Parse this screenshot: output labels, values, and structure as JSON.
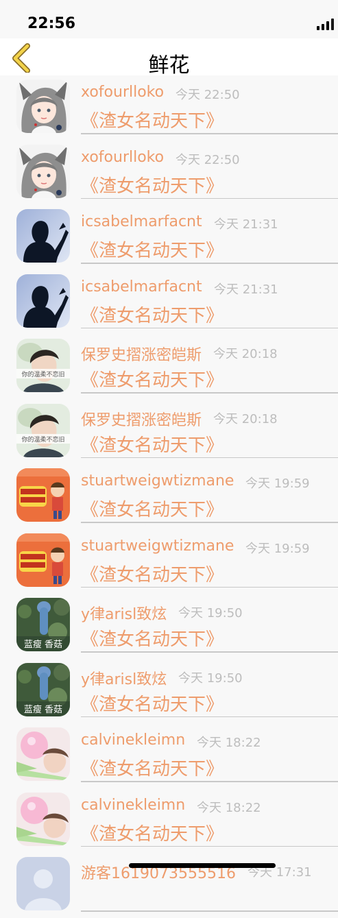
{
  "status_bar": {
    "time": "22:56"
  },
  "nav": {
    "title": "鲜花",
    "back_icon": "chevron-left-icon"
  },
  "accent_color": "#ee9c6c",
  "items": [
    {
      "name": "xofourlloko",
      "time": "今天 22:50",
      "content": "《渣女名动天下》",
      "avatar": "anime-girl"
    },
    {
      "name": "xofourlloko",
      "time": "今天 22:50",
      "content": "《渣女名动天下》",
      "avatar": "anime-girl"
    },
    {
      "name": "icsabelmarfacnt",
      "time": "今天 21:31",
      "content": "《渣女名动天下》",
      "avatar": "silhouette"
    },
    {
      "name": "icsabelmarfacnt",
      "time": "今天 21:31",
      "content": "《渣女名动天下》",
      "avatar": "silhouette"
    },
    {
      "name": "保罗史摺涨密皑斯",
      "time": "今天 20:18",
      "content": "《渣女名动天下》",
      "avatar": "boy",
      "avatar_caption": "你的温柔不恋旧"
    },
    {
      "name": "保罗史摺涨密皑斯",
      "time": "今天 20:18",
      "content": "《渣女名动天下》",
      "avatar": "boy",
      "avatar_caption": "你的温柔不恋旧"
    },
    {
      "name": "stuartweigwtizmane",
      "time": "今天 19:59",
      "content": "《渣女名动天下》",
      "avatar": "cartoon"
    },
    {
      "name": "stuartweigwtizmane",
      "time": "今天 19:59",
      "content": "《渣女名动天下》",
      "avatar": "cartoon"
    },
    {
      "name": "y律arisl致炫",
      "time": "今天 19:50",
      "content": "《渣女名动天下》",
      "avatar": "mushroom",
      "avatar_caption": "蓝瘦 香菇"
    },
    {
      "name": "y律arisl致炫",
      "time": "今天 19:50",
      "content": "《渣女名动天下》",
      "avatar": "mushroom",
      "avatar_caption": "蓝瘦 香菇"
    },
    {
      "name": "calvinekleimn",
      "time": "今天 18:22",
      "content": "《渣女名动天下》",
      "avatar": "girl-balloon"
    },
    {
      "name": "calvinekleimn",
      "time": "今天 18:22",
      "content": "《渣女名动天下》",
      "avatar": "girl-balloon"
    },
    {
      "name": "游客1619073555516",
      "time": "今天 17:31",
      "content": "",
      "avatar": "default"
    }
  ]
}
